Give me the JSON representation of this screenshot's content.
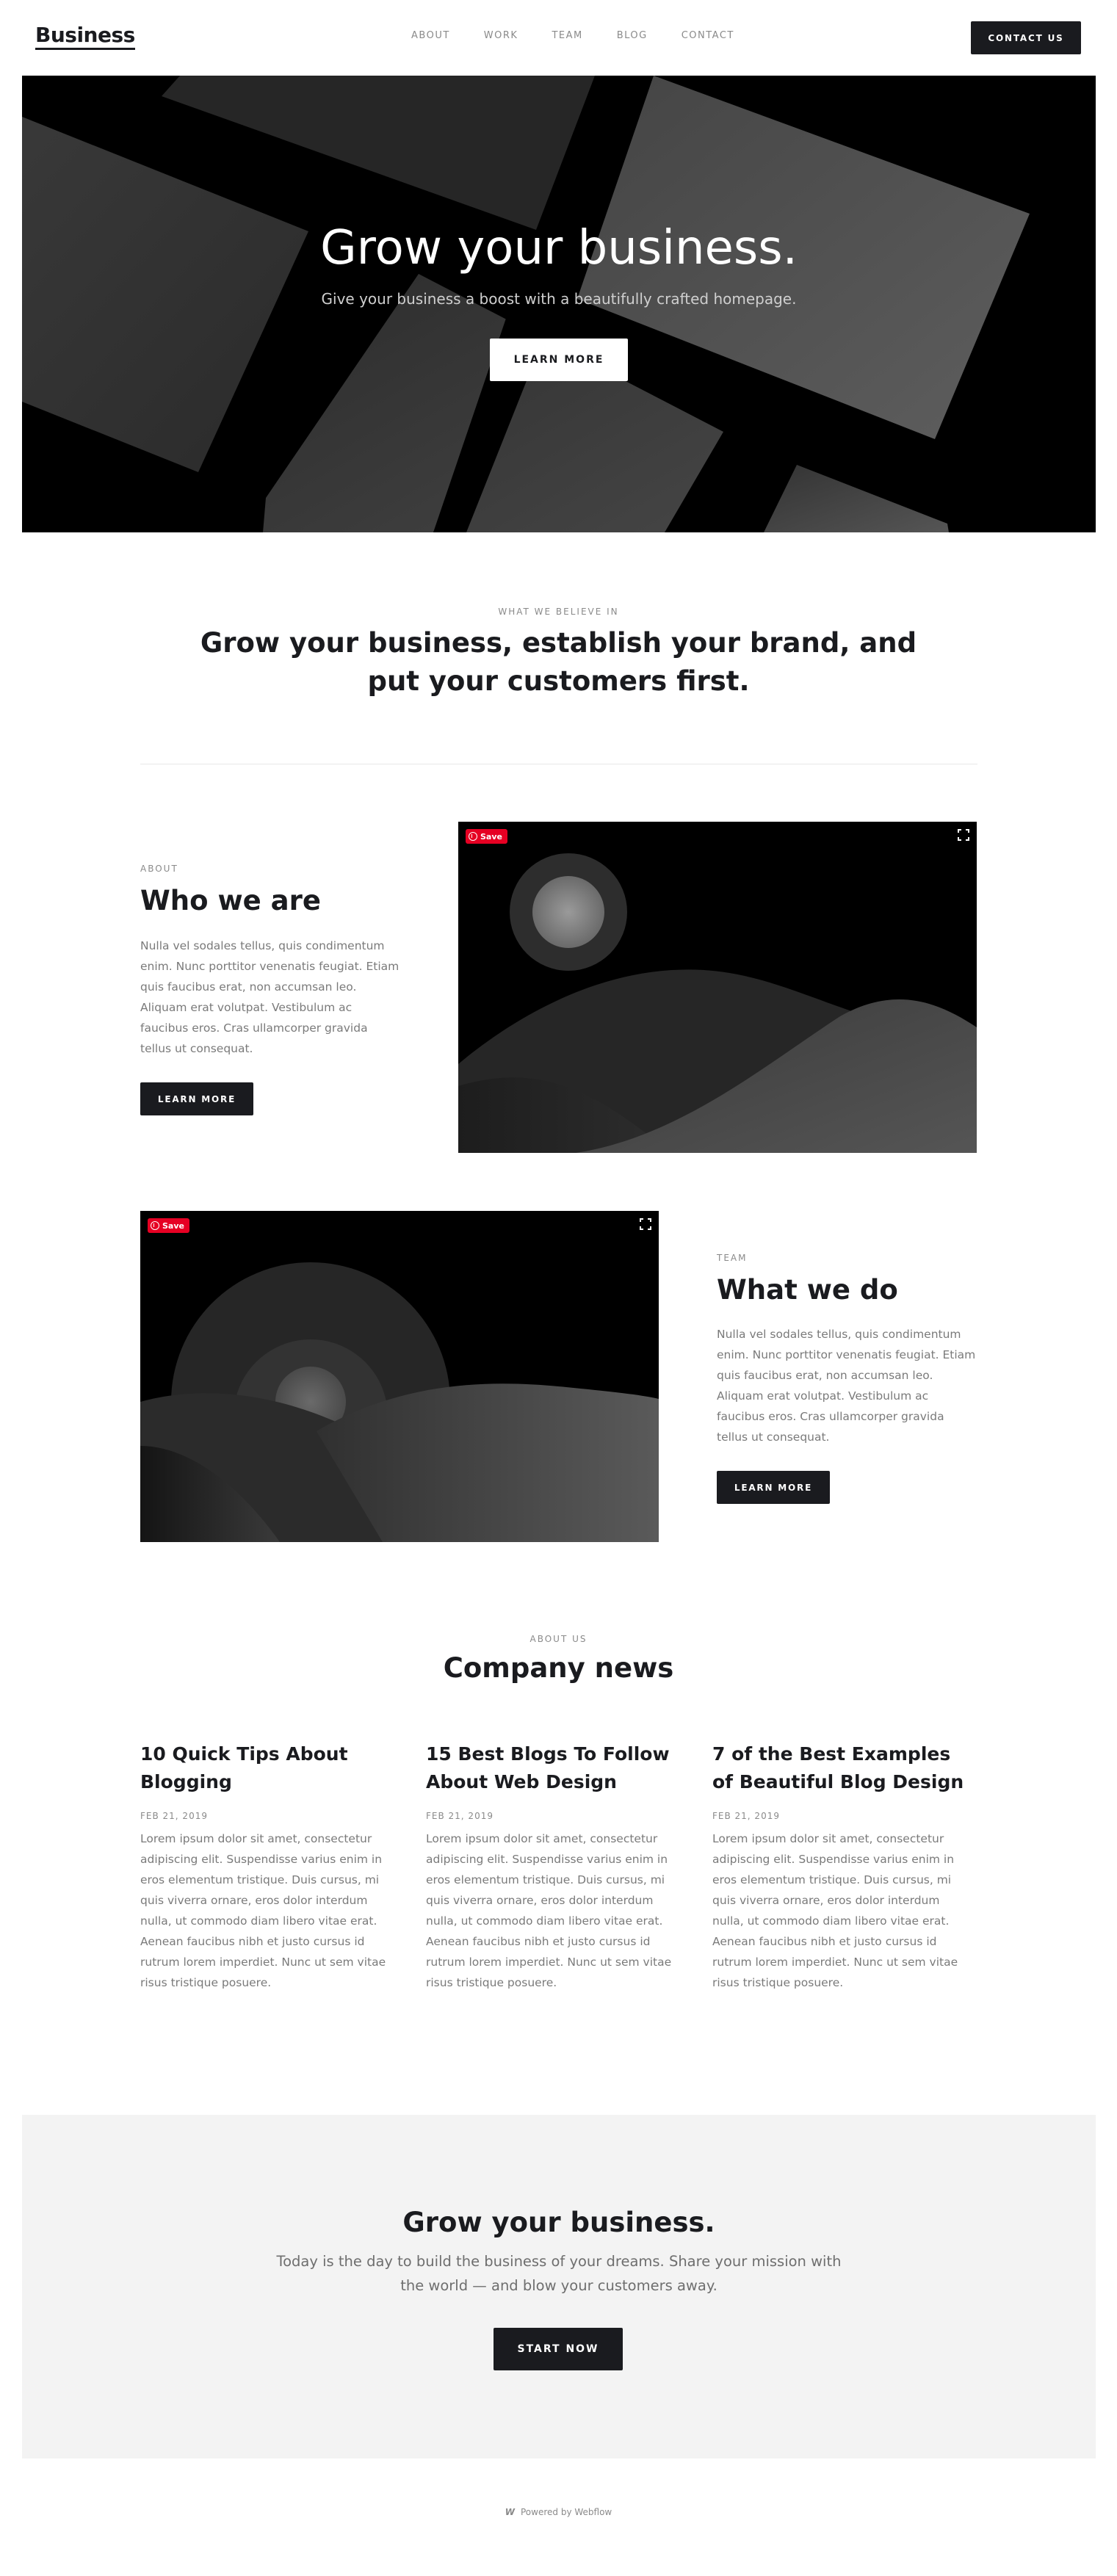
{
  "nav": {
    "brand": "Business",
    "links": [
      "ABOUT",
      "WORK",
      "TEAM",
      "BLOG",
      "CONTACT"
    ],
    "cta": "CONTACT US"
  },
  "hero": {
    "title": "Grow your business.",
    "subtitle": "Give your business a boost with a beautifully crafted homepage.",
    "button": "LEARN MORE"
  },
  "believe": {
    "eyebrow": "WHAT WE BELIEVE IN",
    "title": "Grow your business, establish your brand, and put your customers first."
  },
  "about": {
    "eyebrow": "ABOUT",
    "title": "Who we are",
    "text": "Nulla vel sodales tellus, quis condimentum enim. Nunc porttitor venenatis feugiat. Etiam quis faucibus erat, non accumsan leo. Aliquam erat volutpat. Vestibulum ac faucibus eros. Cras ullamcorper gravida tellus ut consequat.",
    "button": "LEARN MORE",
    "save": "Save"
  },
  "team": {
    "eyebrow": "TEAM",
    "title": "What we do",
    "text": "Nulla vel sodales tellus, quis condimentum enim. Nunc porttitor venenatis feugiat. Etiam quis faucibus erat, non accumsan leo. Aliquam erat volutpat. Vestibulum ac faucibus eros. Cras ullamcorper gravida tellus ut consequat.",
    "button": "LEARN MORE",
    "save": "Save"
  },
  "news": {
    "eyebrow": "ABOUT US",
    "title": "Company news",
    "posts": [
      {
        "title": "10 Quick Tips About Blogging",
        "date": "FEB 21, 2019",
        "text": "Lorem ipsum dolor sit amet, consectetur adipiscing elit. Suspendisse varius enim in eros elementum tristique. Duis cursus, mi quis viverra ornare, eros dolor interdum nulla, ut commodo diam libero vitae erat. Aenean faucibus nibh et justo cursus id rutrum lorem imperdiet. Nunc ut sem vitae risus tristique posuere."
      },
      {
        "title": "15 Best Blogs To Follow About Web Design",
        "date": "FEB 21, 2019",
        "text": "Lorem ipsum dolor sit amet, consectetur adipiscing elit. Suspendisse varius enim in eros elementum tristique. Duis cursus, mi quis viverra ornare, eros dolor interdum nulla, ut commodo diam libero vitae erat. Aenean faucibus nibh et justo cursus id rutrum lorem imperdiet. Nunc ut sem vitae risus tristique posuere."
      },
      {
        "title": "7 of the Best Examples of Beautiful Blog Design",
        "date": "FEB 21, 2019",
        "text": "Lorem ipsum dolor sit amet, consectetur adipiscing elit. Suspendisse varius enim in eros elementum tristique. Duis cursus, mi quis viverra ornare, eros dolor interdum nulla, ut commodo diam libero vitae erat. Aenean faucibus nibh et justo cursus id rutrum lorem imperdiet. Nunc ut sem vitae risus tristique posuere."
      }
    ]
  },
  "cta": {
    "title": "Grow your business.",
    "text": "Today is the day to build the business of your dreams. Share your mission with the world — and blow your customers away.",
    "button": "START NOW"
  },
  "footer": {
    "icon": "webflow-icon",
    "text": "Powered by Webflow"
  },
  "colors": {
    "dark": "#1a1b1f",
    "muted": "#8a8a8a",
    "cta_background": "#f3f3f3",
    "pinterest": "#e60023"
  }
}
